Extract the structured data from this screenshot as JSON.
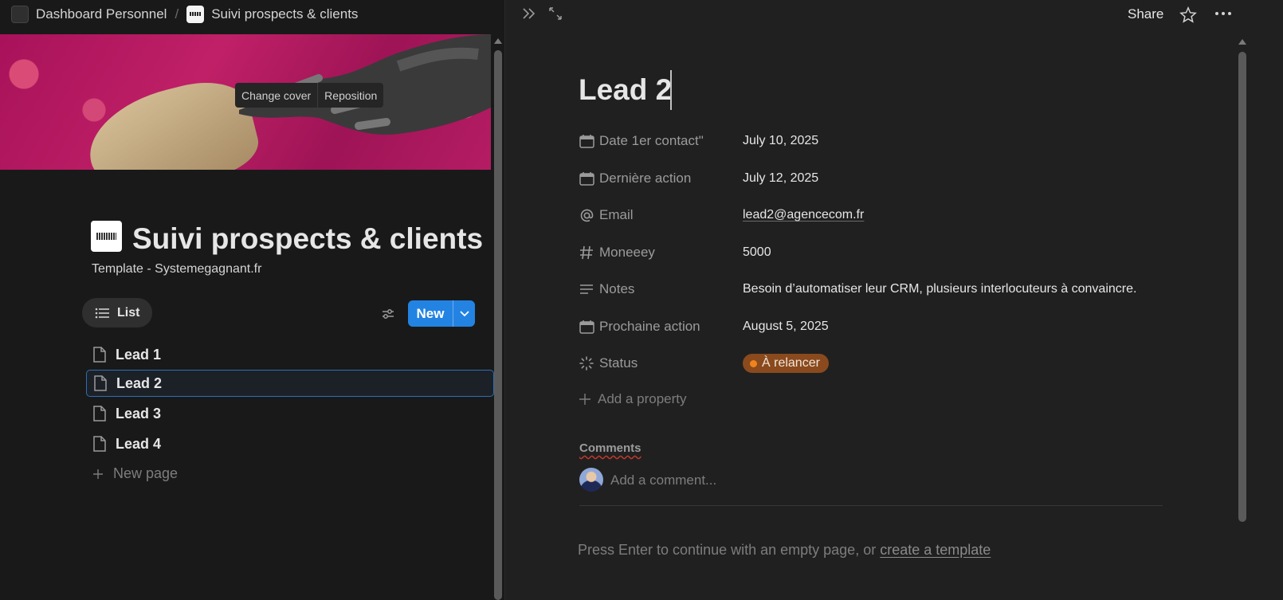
{
  "breadcrumb": {
    "workspace": "Dashboard Personnel",
    "separator": "/",
    "database": "Suivi prospects & clients"
  },
  "cover": {
    "change_label": "Change cover",
    "reposition_label": "Reposition"
  },
  "database": {
    "title": "Suivi prospects & clients",
    "subtitle": "Template - Systemegagnant.fr",
    "view_label": "List",
    "new_label": "New",
    "rows": [
      "Lead 1",
      "Lead 2",
      "Lead 3",
      "Lead 4"
    ],
    "selected_row": "Lead 2",
    "new_page_label": "New page"
  },
  "peek": {
    "share_label": "Share",
    "title": "Lead 2",
    "properties": [
      {
        "icon": "calendar-icon",
        "name": "Date 1er contact\"",
        "value": "July 10, 2025"
      },
      {
        "icon": "calendar-icon",
        "name": "Dernière action",
        "value": "July 12, 2025"
      },
      {
        "icon": "at-icon",
        "name": "Email",
        "value": "lead2@agencecom.fr"
      },
      {
        "icon": "hash-icon",
        "name": "Moneeey",
        "value": "5000"
      },
      {
        "icon": "lines-icon",
        "name": "Notes",
        "value": "Besoin d’automatiser leur CRM, plusieurs interlocuteurs à convaincre."
      },
      {
        "icon": "calendar-icon",
        "name": "Prochaine action",
        "value": "August 5, 2025"
      },
      {
        "icon": "status-icon",
        "name": "Status",
        "value": "À relancer"
      }
    ],
    "add_property_label": "Add a property",
    "comments_label": "Comments",
    "comment_placeholder": "Add a comment...",
    "hint_prefix": "Press Enter to continue with an empty page, or ",
    "hint_link": "create a template"
  },
  "colors": {
    "accent": "#2383e2",
    "status_badge": "#8a4a1d",
    "status_dot": "#f0841c"
  }
}
